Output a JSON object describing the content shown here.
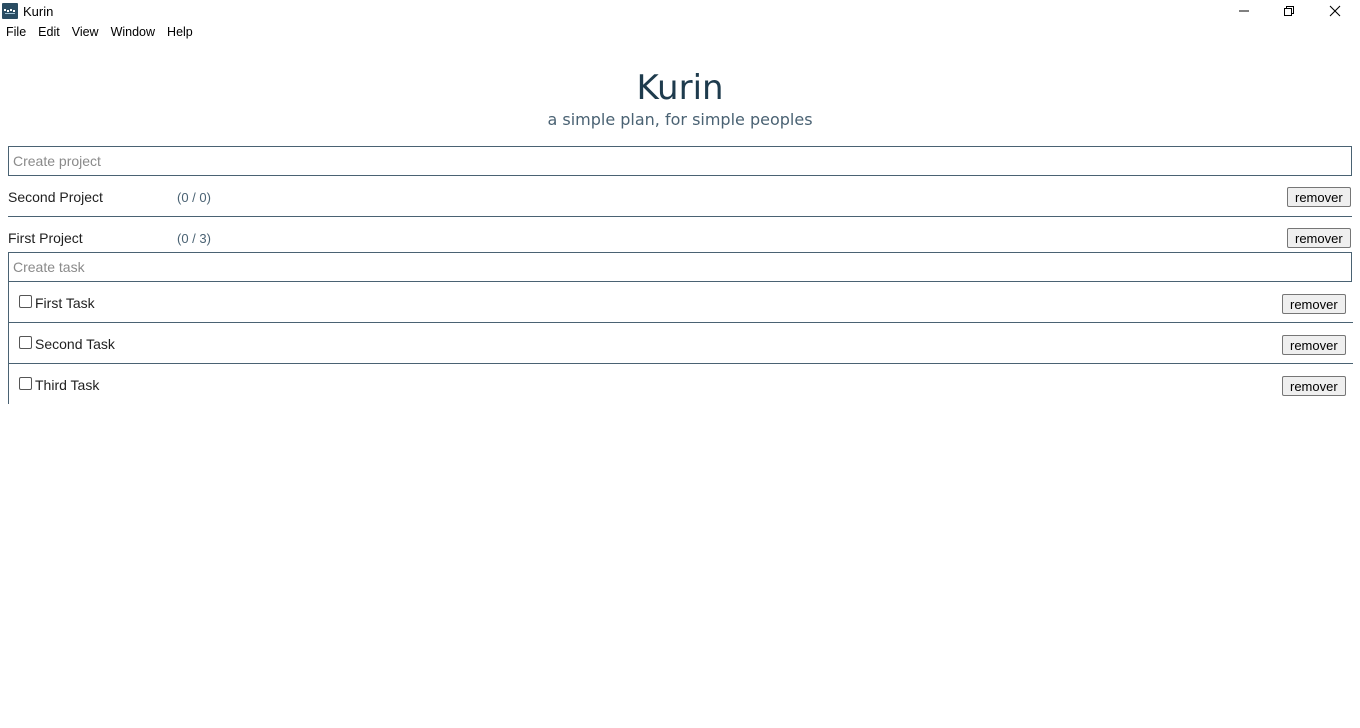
{
  "window": {
    "title": "Kurin",
    "app_icon": "kurin-logo-icon",
    "controls": [
      "minimize-icon",
      "restore-icon",
      "close-icon"
    ]
  },
  "menu": {
    "items": [
      "File",
      "Edit",
      "View",
      "Window",
      "Help"
    ]
  },
  "header": {
    "title": "Kurin",
    "subtitle": "a simple plan, for simple peoples"
  },
  "create_project": {
    "placeholder": "Create project",
    "value": ""
  },
  "projects": [
    {
      "name": "Second Project",
      "count": "(0 / 0)",
      "remove_label": "remover"
    },
    {
      "name": "First Project",
      "count": "(0 / 3)",
      "remove_label": "remover"
    }
  ],
  "create_task": {
    "placeholder": "Create task",
    "value": ""
  },
  "tasks": [
    {
      "label": "First Task",
      "checked": false,
      "remove_label": "remover"
    },
    {
      "label": "Second Task",
      "checked": false,
      "remove_label": "remover"
    },
    {
      "label": "Third Task",
      "checked": false,
      "remove_label": "remover"
    }
  ],
  "colors": {
    "accent": "#1e3b4d",
    "border": "#4a6273",
    "subtitle": "#4a6273"
  }
}
